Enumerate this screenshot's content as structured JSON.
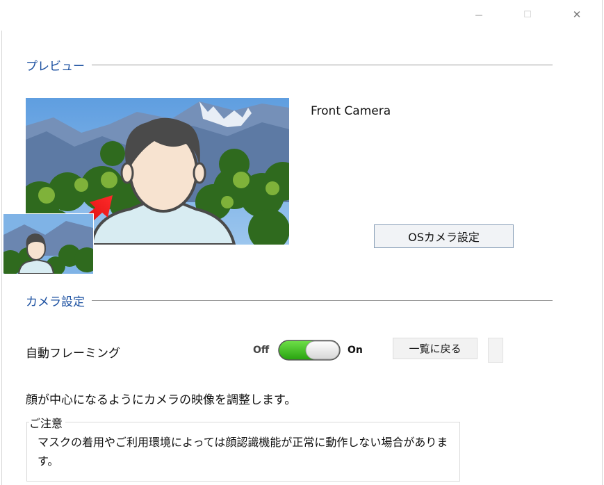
{
  "window": {
    "minimize_glyph": "—",
    "maximize_glyph": "☐",
    "close_glyph": "✕"
  },
  "preview_section": {
    "title": "プレビュー",
    "camera_name": "Front Camera",
    "os_camera_button": "OSカメラ設定"
  },
  "camera_section": {
    "title": "カメラ設定",
    "auto_framing_label": "自動フレーミング",
    "toggle_off_label": "Off",
    "toggle_on_label": "On",
    "auto_framing_enabled": true,
    "back_button": "一覧に戻る",
    "description": "顔が中心になるようにカメラの映像を調整します。",
    "notice_title": "ご注意",
    "notice_text": "マスクの着用やご利用環境によっては顔認識機能が正常に動作しない場合があります。"
  },
  "colors": {
    "section_title": "#1a4fa0",
    "toggle_on": "#3cc21c",
    "arrow": "#e00000"
  }
}
